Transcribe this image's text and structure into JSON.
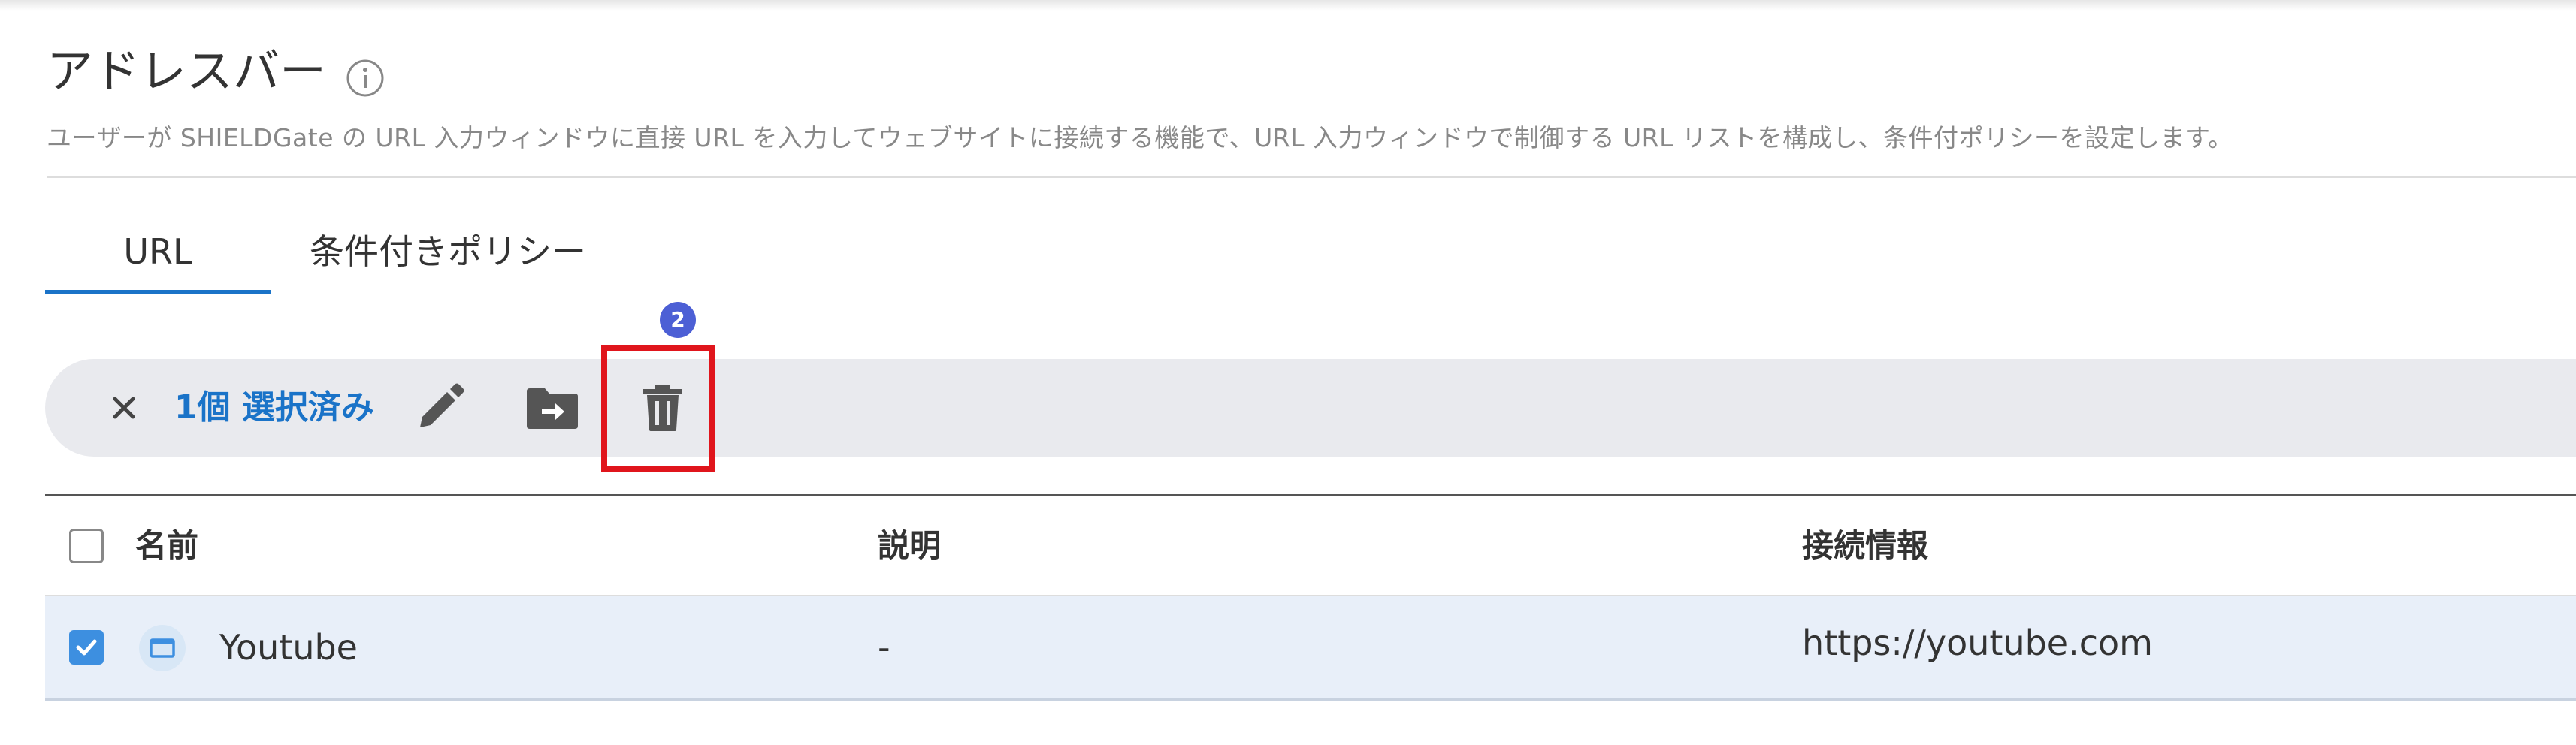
{
  "page": {
    "title": "アドレスバー",
    "description": "ユーザーが SHIELDGate の URL 入力ウィンドウに直接 URL を入力してウェブサイトに接続する機能で、URL 入力ウィンドウで制御する URL リストを構成し、条件付ポリシーを設定します。"
  },
  "tabs": [
    {
      "label": "URL",
      "active": true
    },
    {
      "label": "条件付きポリシー",
      "active": false
    }
  ],
  "step_badge": "2",
  "toolbar": {
    "close_icon": "close-icon",
    "selection_label": "1個 選択済み",
    "edit_icon": "pencil-icon",
    "move_icon": "folder-move-icon",
    "delete_icon": "trash-icon"
  },
  "table": {
    "columns": [
      "名前",
      "説明",
      "接続情報"
    ],
    "rows": [
      {
        "checked": true,
        "icon": "browser-window-icon",
        "name": "Youtube",
        "description": "-",
        "connection": "https://youtube.com"
      }
    ]
  },
  "colors": {
    "accent": "#1a73c8",
    "highlight": "#e0151c",
    "badge": "#4c5fd5",
    "toolbar_bg": "#e9eaee",
    "selected_row_bg": "#e8eff9"
  }
}
